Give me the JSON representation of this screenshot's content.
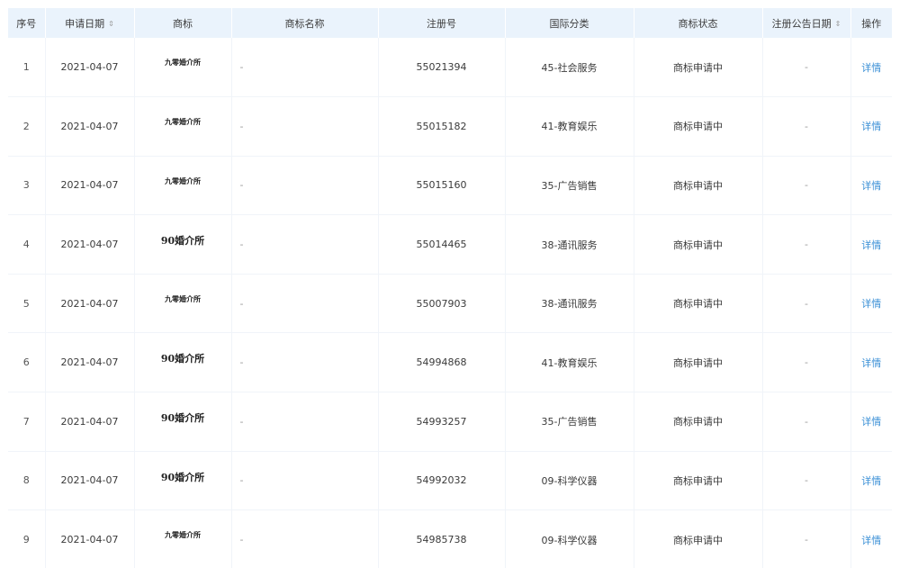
{
  "table": {
    "headers": {
      "index": "序号",
      "date": "申请日期",
      "mark": "商标",
      "name": "商标名称",
      "reg_no": "注册号",
      "class": "国际分类",
      "status": "商标状态",
      "notice_date": "注册公告日期",
      "operation": "操作"
    },
    "sort_icon": "⇕",
    "rows": [
      {
        "index": "1",
        "date": "2021-04-07",
        "mark": "九零婚介所",
        "mark_style": "small",
        "name": "-",
        "reg_no": "55021394",
        "class": "45-社会服务",
        "status": "商标申请中",
        "notice_date": "-",
        "action": "详情"
      },
      {
        "index": "2",
        "date": "2021-04-07",
        "mark": "九零婚介所",
        "mark_style": "small",
        "name": "-",
        "reg_no": "55015182",
        "class": "41-教育娱乐",
        "status": "商标申请中",
        "notice_date": "-",
        "action": "详情"
      },
      {
        "index": "3",
        "date": "2021-04-07",
        "mark": "九零婚介所",
        "mark_style": "small",
        "name": "-",
        "reg_no": "55015160",
        "class": "35-广告销售",
        "status": "商标申请中",
        "notice_date": "-",
        "action": "详情"
      },
      {
        "index": "4",
        "date": "2021-04-07",
        "mark": "90婚介所",
        "mark_style": "large",
        "name": "-",
        "reg_no": "55014465",
        "class": "38-通讯服务",
        "status": "商标申请中",
        "notice_date": "-",
        "action": "详情"
      },
      {
        "index": "5",
        "date": "2021-04-07",
        "mark": "九零婚介所",
        "mark_style": "small",
        "name": "-",
        "reg_no": "55007903",
        "class": "38-通讯服务",
        "status": "商标申请中",
        "notice_date": "-",
        "action": "详情"
      },
      {
        "index": "6",
        "date": "2021-04-07",
        "mark": "90婚介所",
        "mark_style": "large",
        "name": "-",
        "reg_no": "54994868",
        "class": "41-教育娱乐",
        "status": "商标申请中",
        "notice_date": "-",
        "action": "详情"
      },
      {
        "index": "7",
        "date": "2021-04-07",
        "mark": "90婚介所",
        "mark_style": "large",
        "name": "-",
        "reg_no": "54993257",
        "class": "35-广告销售",
        "status": "商标申请中",
        "notice_date": "-",
        "action": "详情"
      },
      {
        "index": "8",
        "date": "2021-04-07",
        "mark": "90婚介所",
        "mark_style": "large",
        "name": "-",
        "reg_no": "54992032",
        "class": "09-科学仪器",
        "status": "商标申请中",
        "notice_date": "-",
        "action": "详情"
      },
      {
        "index": "9",
        "date": "2021-04-07",
        "mark": "九零婚介所",
        "mark_style": "small",
        "name": "-",
        "reg_no": "54985738",
        "class": "09-科学仪器",
        "status": "商标申请中",
        "notice_date": "-",
        "action": "详情"
      }
    ]
  },
  "colors": {
    "header_bg": "#eaf3fc",
    "link": "#3a8fd6",
    "row_border": "#f0f4f9"
  }
}
